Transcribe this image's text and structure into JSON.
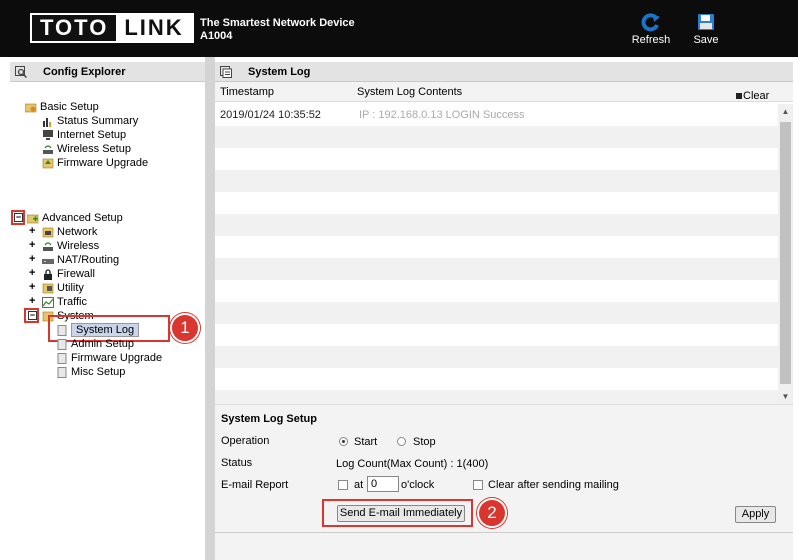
{
  "header": {
    "logo_left": "TOTO",
    "logo_right": "LINK",
    "tagline": "The Smartest Network Device",
    "model": "A1004",
    "refresh_label": "Refresh",
    "save_label": "Save"
  },
  "explorer": {
    "title": "Config Explorer",
    "basic_setup": "Basic Setup",
    "basic_items": [
      "Status Summary",
      "Internet Setup",
      "Wireless Setup",
      "Firmware Upgrade"
    ],
    "advanced_setup": "Advanced Setup",
    "advanced_items": [
      "Network",
      "Wireless",
      "NAT/Routing",
      "Firewall",
      "Utility",
      "Traffic",
      "System"
    ],
    "system_items": [
      "System Log",
      "Admin Setup",
      "Firmware Upgrade",
      "Misc Setup"
    ],
    "badge1": "1",
    "badge2": "2"
  },
  "syslog": {
    "title": "System Log",
    "col_timestamp": "Timestamp",
    "col_contents": "System Log Contents",
    "clear_label": "Clear",
    "rows": [
      {
        "timestamp": "2019/01/24 10:35:52",
        "contents": "IP : 192.168.0.13 LOGIN Success"
      }
    ]
  },
  "setup": {
    "title": "System Log Setup",
    "operation_label": "Operation",
    "start_label": "Start",
    "stop_label": "Stop",
    "status_label": "Status",
    "status_value": "Log Count(Max Count) : 1(400)",
    "email_label": "E-mail Report",
    "at_label": "at",
    "hour_value": "0",
    "oclock_label": "o'clock",
    "clear_after_label": "Clear after sending mailing",
    "send_email_label": "Send E-mail Immediately",
    "apply_label": "Apply"
  },
  "colors": {
    "accent_red": "#d9362f",
    "header_bg": "#0c0c0c",
    "refresh_blue": "#1a74c9"
  }
}
